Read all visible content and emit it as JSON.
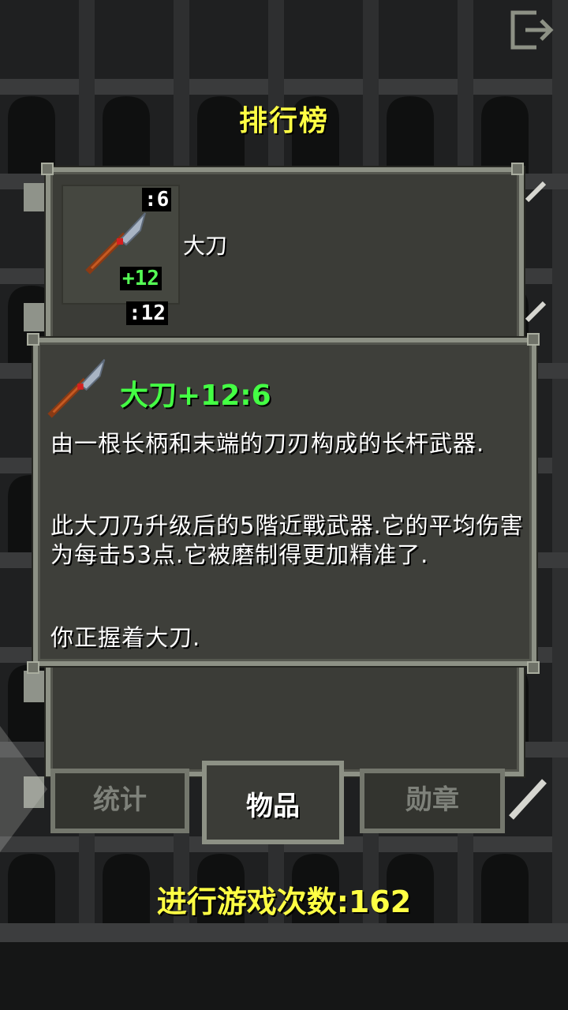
{
  "header": {
    "title": "排行榜",
    "exit_icon": "exit-door-icon"
  },
  "rank_entry": {
    "item_name": "大刀",
    "depth_badge": ":6",
    "upgrade_badge": "+12",
    "next_entry_badge": ":12",
    "icon": "glaive-icon"
  },
  "item_info": {
    "title": "大刀+12:6",
    "title_color": "#44ff44",
    "icon": "glaive-icon",
    "paragraphs": [
      "由一根长柄和末端的刀刃构成的长杆武器.",
      "此大刀乃升级后的5階近戰武器.它的平均伤害为每击53点.它被磨制得更加精准了.",
      "你正握着大刀."
    ]
  },
  "tabs": [
    {
      "label": "统计",
      "active": false
    },
    {
      "label": "物品",
      "active": true
    },
    {
      "label": "勋章",
      "active": false
    }
  ],
  "footer": {
    "games_played": "进行游戏次数:162"
  },
  "colors": {
    "accent_yellow": "#ffff44",
    "panel_border": "#8d9185",
    "panel_fill": "#3b3c37"
  }
}
